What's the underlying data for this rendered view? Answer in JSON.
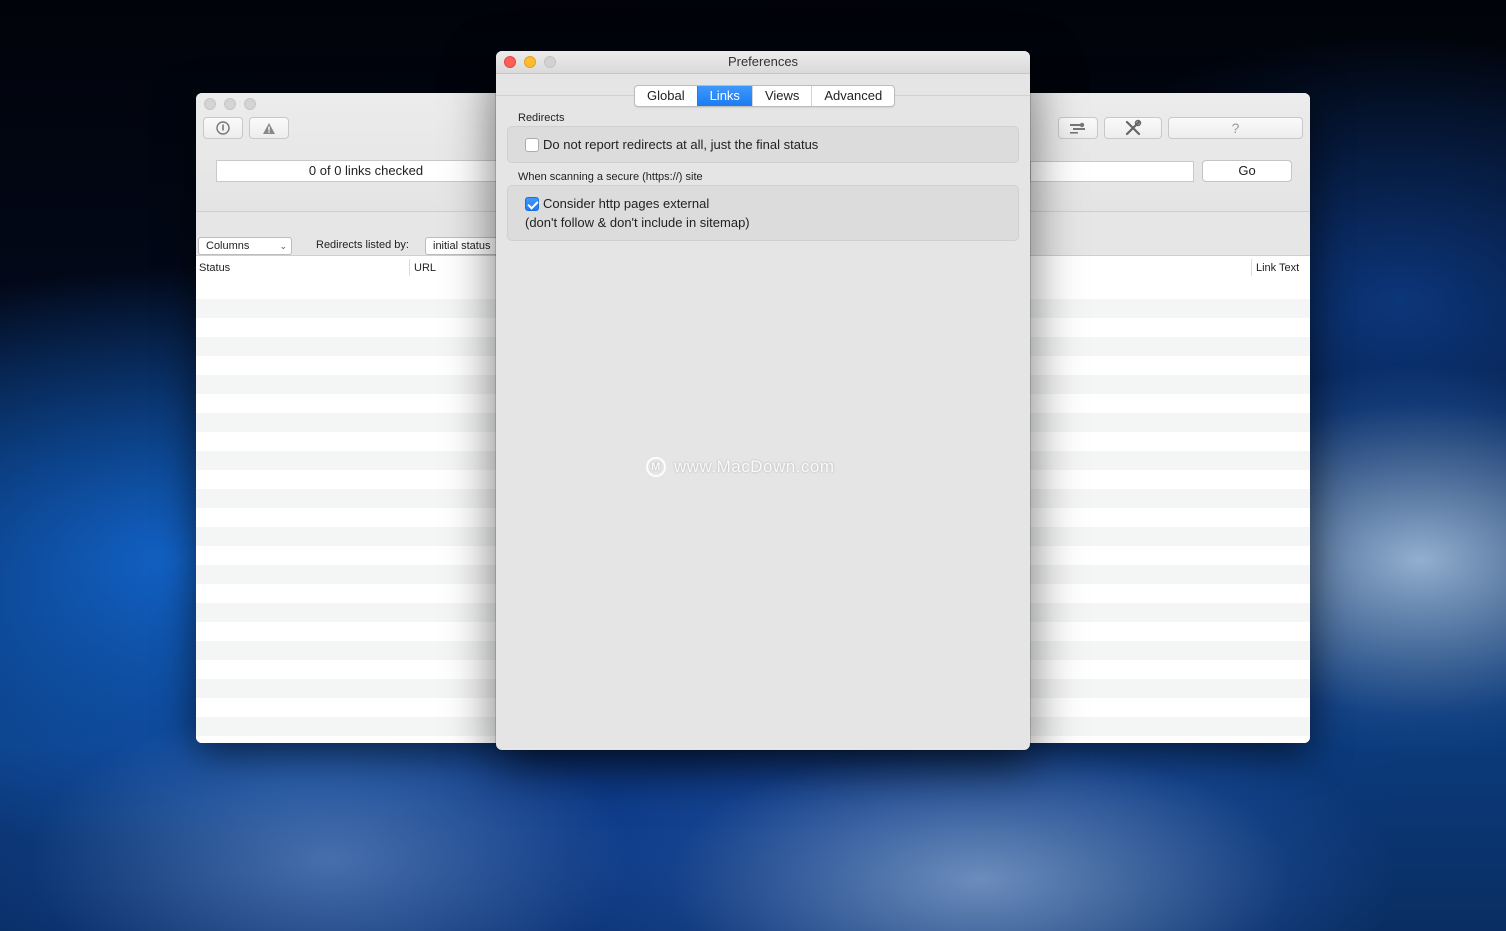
{
  "main_window": {
    "status_text": "0 of 0 links checked",
    "go_label": "Go",
    "columns_popup": "Columns",
    "redirects_label": "Redirects listed by:",
    "redirects_popup": "initial status",
    "table_headers": {
      "status": "Status",
      "url": "URL",
      "link_text": "Link Text"
    },
    "toolbar_icons": [
      "info-icon",
      "warning-icon",
      "settings-icon",
      "tools-icon",
      "help-icon"
    ],
    "help_label": "?"
  },
  "prefs_window": {
    "title": "Preferences",
    "tabs": [
      {
        "label": "Global",
        "active": false
      },
      {
        "label": "Links",
        "active": true
      },
      {
        "label": "Views",
        "active": false
      },
      {
        "label": "Advanced",
        "active": false
      }
    ],
    "redirects_section": {
      "label": "Redirects",
      "option": {
        "label": "Do not report redirects at all, just the final status",
        "checked": false
      }
    },
    "secure_section": {
      "label": "When scanning a secure (https://) site",
      "option": {
        "label": "Consider http pages external",
        "checked": true
      },
      "note": "(don't follow & don't include in sitemap)"
    }
  },
  "watermark": "www.MacDown.com",
  "colors": {
    "accent": "#1d7bf3",
    "close_button": "#fd5f57",
    "minimize_button": "#febb2e"
  }
}
